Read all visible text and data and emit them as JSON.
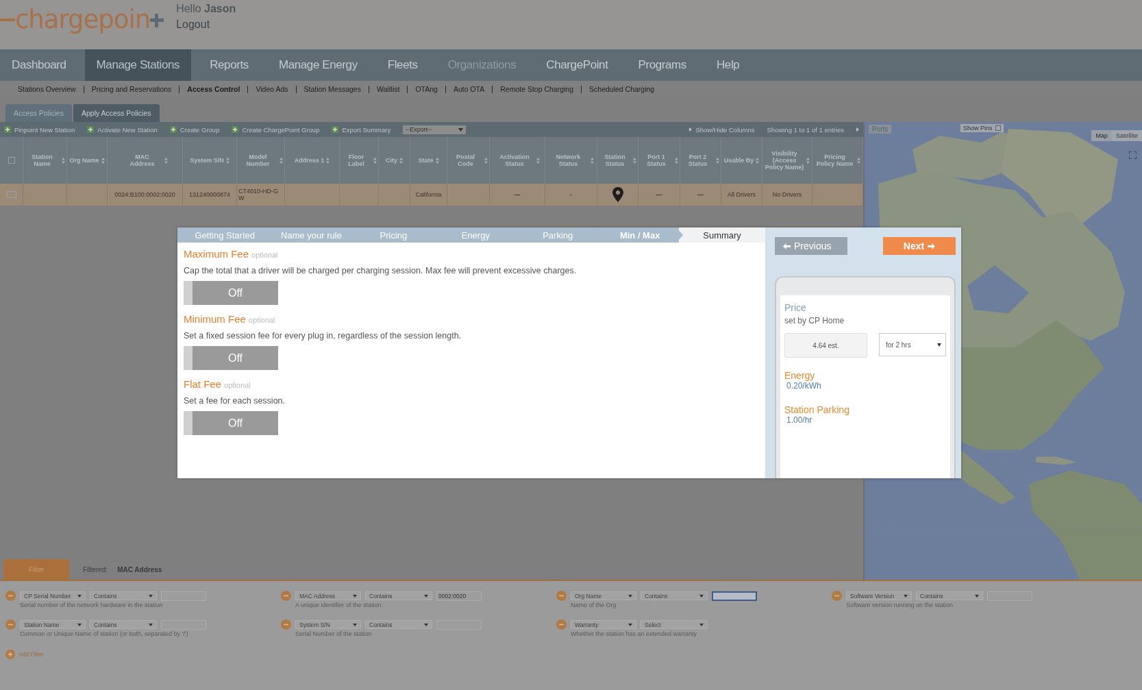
{
  "header": {
    "logo": "chargepoin",
    "greeting": "Hello **Jason**",
    "logout": "Logout"
  },
  "nav": [
    {
      "label": "Dashboard",
      "selected": false,
      "disabled": false
    },
    {
      "label": "Manage Stations",
      "selected": true,
      "disabled": false
    },
    {
      "label": "Reports",
      "selected": false,
      "disabled": false
    },
    {
      "label": "Manage Energy",
      "selected": false,
      "disabled": false
    },
    {
      "label": "Fleets",
      "selected": false,
      "disabled": false
    },
    {
      "label": "Organizations",
      "selected": false,
      "disabled": true
    },
    {
      "label": "ChargePoint",
      "selected": false,
      "disabled": false
    },
    {
      "label": "Programs",
      "selected": false,
      "disabled": false
    },
    {
      "label": "Help",
      "selected": false,
      "disabled": false
    }
  ],
  "subnav": [
    {
      "label": "Stations Overview",
      "selected": false
    },
    {
      "label": "Pricing and Reservations",
      "selected": false
    },
    {
      "label": "Access Control",
      "selected": true
    },
    {
      "label": "Video Ads",
      "selected": false
    },
    {
      "label": "Station Messages",
      "selected": false
    },
    {
      "label": "Waitlist",
      "selected": false
    },
    {
      "label": "OTAng",
      "selected": false
    },
    {
      "label": "Auto OTA",
      "selected": false
    },
    {
      "label": "Remote Stop Charging",
      "selected": false
    },
    {
      "label": "Scheduled Charging",
      "selected": false
    }
  ],
  "page_tabs": [
    {
      "label": "Access Policies",
      "selected": false
    },
    {
      "label": "Apply Access Policies",
      "selected": true
    }
  ],
  "toolbar": {
    "actions": [
      "Pinpoint New Station",
      "Activate New Station",
      "Create Group",
      "Create ChargePoint Group",
      "Export Summary"
    ],
    "export_select": "--Export--",
    "show_hide": "Show/Hide Columns",
    "showing": "Showing 1 to 1 of 1 entries"
  },
  "table": {
    "columns": [
      {
        "label": "Station Name",
        "kind": "text"
      },
      {
        "label": "Org Name",
        "kind": "text"
      },
      {
        "label": "MAC Address",
        "kind": "text"
      },
      {
        "label": "System S/N",
        "kind": "text"
      },
      {
        "label": "Model Number",
        "kind": "text"
      },
      {
        "label": "Address 1",
        "kind": "text"
      },
      {
        "label": "Floor Label",
        "kind": "text"
      },
      {
        "label": "City",
        "kind": "text"
      },
      {
        "label": "State",
        "kind": "text"
      },
      {
        "label": "Postal Code",
        "kind": "text"
      },
      {
        "label": "Activation Status",
        "kind": "text"
      },
      {
        "label": "Network Status",
        "kind": "text"
      },
      {
        "label": "Station Status",
        "kind": "status"
      },
      {
        "label": "Port 1 Status",
        "kind": "text"
      },
      {
        "label": "Port 2 Status",
        "kind": "text"
      },
      {
        "label": "Usable By",
        "kind": "text"
      },
      {
        "label": "Visibility (Access Policy Name)",
        "kind": "text"
      },
      {
        "label": "Pricing Policy Name",
        "kind": "text"
      }
    ],
    "all_checked": false,
    "rows": [
      {
        "checked": false,
        "cells": [
          null,
          null,
          "0024:B100:0002:0020",
          "131240000874",
          "CT4010-HD-GW",
          null,
          null,
          null,
          "California",
          null,
          "—",
          "-",
          null,
          "—",
          "—",
          "All Drivers",
          "No Drivers",
          null
        ]
      }
    ]
  },
  "map": {
    "ports_label": "Ports",
    "show_pins": "Show Pins",
    "show_pins_checked": false,
    "map_types": [
      {
        "label": "Map",
        "selected": true
      },
      {
        "label": "Satellite",
        "selected": false
      }
    ]
  },
  "filter": {
    "tab": "Filter",
    "filtered_label": "Filtered:",
    "filtered_value": "MAC Address",
    "add": "Add Filter",
    "items": [
      {
        "field": "CP Serial Number",
        "operator": "Contains",
        "kind": "text",
        "focused": false,
        "description": "Serial number of the network hardware in the station"
      },
      {
        "field": "MAC Address",
        "operator": "Contains",
        "kind": "text",
        "value": "0002:0020",
        "focused": false,
        "description": "A unique identifier of the station"
      },
      {
        "field": "Org Name",
        "operator": "Contains",
        "kind": "text",
        "focused": true,
        "description": "Name of the Org"
      },
      {
        "field": "Software Version",
        "operator": "Contains",
        "kind": "text",
        "focused": false,
        "description": "Software version running on the station"
      },
      {
        "field": "Station Name",
        "operator": "Contains",
        "kind": "text",
        "focused": false,
        "description": "Common or Unique Name of station (or both, separated by '/')"
      },
      {
        "field": "System S/N",
        "operator": "Contains",
        "kind": "text",
        "focused": false,
        "description": "Serial Number of the station"
      },
      {
        "field": "Warranty",
        "operator": "Select",
        "kind": "choice",
        "focused": false,
        "description": "Whether the station has an extended warranty"
      }
    ]
  },
  "modal": {
    "steps": [
      {
        "label": "Getting Started",
        "completed": true,
        "selected": false
      },
      {
        "label": "Name your rule",
        "completed": true,
        "selected": false
      },
      {
        "label": "Pricing",
        "completed": true,
        "selected": false
      },
      {
        "label": "Energy",
        "completed": true,
        "selected": false
      },
      {
        "label": "Parking",
        "completed": true,
        "selected": false
      },
      {
        "label": "Min / Max",
        "completed": true,
        "selected": true
      },
      {
        "label": "Summary",
        "completed": false,
        "selected": false
      }
    ],
    "sections": [
      {
        "title": "Maximum Fee",
        "optional": "optional",
        "description": "Cap the total that a driver will be charged per charging session. Max fee will prevent excessive charges.",
        "toggle": "Off",
        "on": false
      },
      {
        "title": "Minimum Fee",
        "optional": "optional",
        "description": "Set a fixed session fee for every plug in, regardless of the session length.",
        "toggle": "Off",
        "on": false
      },
      {
        "title": "Flat Fee",
        "optional": "optional",
        "description": "Set a fee for each session.",
        "toggle": "Off",
        "on": false
      }
    ],
    "previous": {
      "label": "Previous",
      "disabled": true
    },
    "next": {
      "label": "Next",
      "disabled": false
    },
    "preview": {
      "price_title": "Price",
      "price_sub": "set by CP Home",
      "estimate": "4.64 est.",
      "duration": "for 2 hrs",
      "items": [
        {
          "title": "Energy",
          "value": "0.20/kWh"
        },
        {
          "title": "Station Parking",
          "value": "1.00/hr"
        }
      ]
    }
  }
}
